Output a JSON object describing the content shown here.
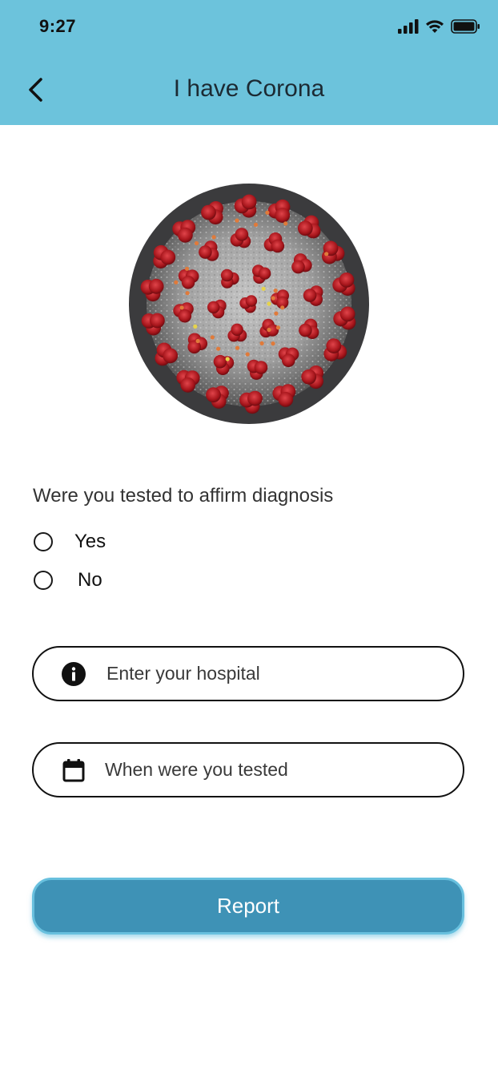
{
  "status_bar": {
    "time": "9:27",
    "icons": [
      "signal-icon",
      "wifi-icon",
      "battery-icon"
    ]
  },
  "header": {
    "title": "I have Corona",
    "back_icon": "chevron-left-icon",
    "background_color": "#6cc3dc"
  },
  "hero_image": {
    "icon": "coronavirus-illustration"
  },
  "form": {
    "question": "Were you tested to affirm diagnosis",
    "options": [
      {
        "label": "Yes",
        "selected": false
      },
      {
        "label": "No",
        "selected": false
      }
    ],
    "hospital_field": {
      "placeholder": "Enter your hospital",
      "icon": "info-icon"
    },
    "date_field": {
      "placeholder": "When were you tested",
      "icon": "calendar-icon"
    }
  },
  "actions": {
    "report_label": "Report",
    "button_color": "#3e92b6"
  }
}
